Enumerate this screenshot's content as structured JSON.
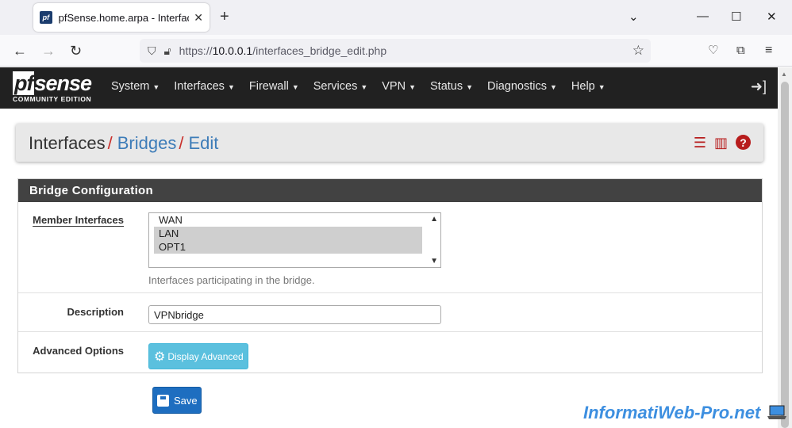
{
  "browser": {
    "tab_title": "pfSense.home.arpa - Interfaces: Bridges: Edit",
    "url_prefix": "https://",
    "url_host": "10.0.0.1",
    "url_path": "/interfaces_bridge_edit.php"
  },
  "pf": {
    "logo_main": "sense",
    "logo_pf": "pf",
    "logo_sub": "COMMUNITY EDITION",
    "menu": [
      "System",
      "Interfaces",
      "Firewall",
      "Services",
      "VPN",
      "Status",
      "Diagnostics",
      "Help"
    ]
  },
  "breadcrumb": {
    "root": "Interfaces",
    "level2": "Bridges",
    "level3": "Edit",
    "separator": "/"
  },
  "panel": {
    "heading": "Bridge Configuration",
    "member_label": "Member Interfaces",
    "member_options": [
      {
        "label": "WAN",
        "selected": false
      },
      {
        "label": "LAN",
        "selected": true
      },
      {
        "label": "OPT1",
        "selected": true
      }
    ],
    "member_help": "Interfaces participating in the bridge.",
    "description_label": "Description",
    "description_value": "VPNbridge",
    "advanced_label": "Advanced Options",
    "advanced_button": "Display Advanced"
  },
  "save_button": "Save",
  "watermark": "InformatiWeb-Pro.net",
  "colors": {
    "header_bg": "#212121",
    "panel_heading_bg": "#424242",
    "breadcrumb_sep": "#c9302c",
    "link": "#3d7cb8",
    "btn_info": "#5bc0de",
    "btn_primary": "#1e6ec0"
  }
}
